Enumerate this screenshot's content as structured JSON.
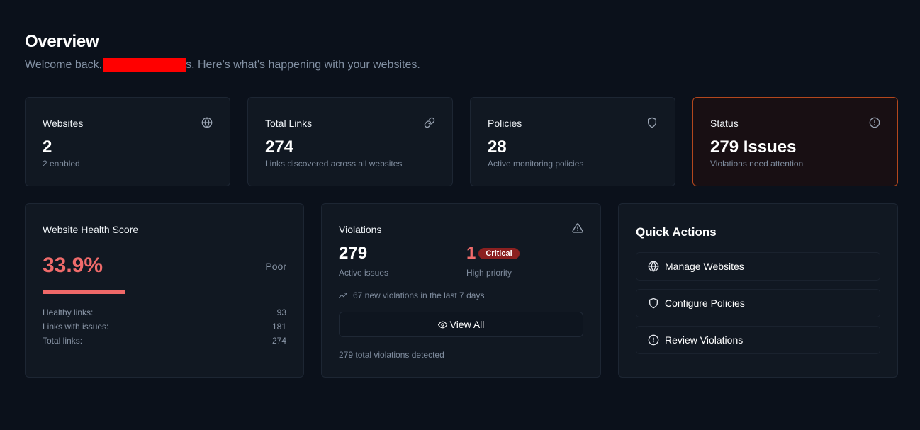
{
  "header": {
    "title": "Overview",
    "welcome_prefix": "Welcome back,",
    "welcome_suffix": "s. Here's what's happening with your websites."
  },
  "stats": [
    {
      "label": "Websites",
      "value": "2",
      "sub": "2 enabled",
      "icon": "globe-icon"
    },
    {
      "label": "Total Links",
      "value": "274",
      "sub": "Links discovered across all websites",
      "icon": "link-icon"
    },
    {
      "label": "Policies",
      "value": "28",
      "sub": "Active monitoring policies",
      "icon": "shield-icon"
    },
    {
      "label": "Status",
      "value": "279 Issues",
      "sub": "Violations need attention",
      "icon": "alert-circle-icon"
    }
  ],
  "health": {
    "title": "Website Health Score",
    "score": "33.9%",
    "score_fraction": 0.339,
    "rating": "Poor",
    "rows": [
      {
        "label": "Healthy links:",
        "value": "93"
      },
      {
        "label": "Links with issues:",
        "value": "181"
      },
      {
        "label": "Total links:",
        "value": "274"
      }
    ]
  },
  "violations": {
    "title": "Violations",
    "active_value": "279",
    "active_label": "Active issues",
    "critical_value": "1",
    "critical_badge": "Critical",
    "critical_label": "High priority",
    "trend_text": "67 new violations in the last 7 days",
    "view_all_label": "View All",
    "total_text": "279 total violations detected"
  },
  "quick_actions": {
    "title": "Quick Actions",
    "items": [
      {
        "label": "Manage Websites",
        "icon": "globe-icon"
      },
      {
        "label": "Configure Policies",
        "icon": "shield-icon"
      },
      {
        "label": "Review Violations",
        "icon": "alert-circle-icon"
      }
    ]
  },
  "colors": {
    "background": "#0b111b",
    "card": "#111822",
    "alert_border": "#b3471d",
    "danger": "#f06b6b",
    "badge": "#8b2020"
  }
}
